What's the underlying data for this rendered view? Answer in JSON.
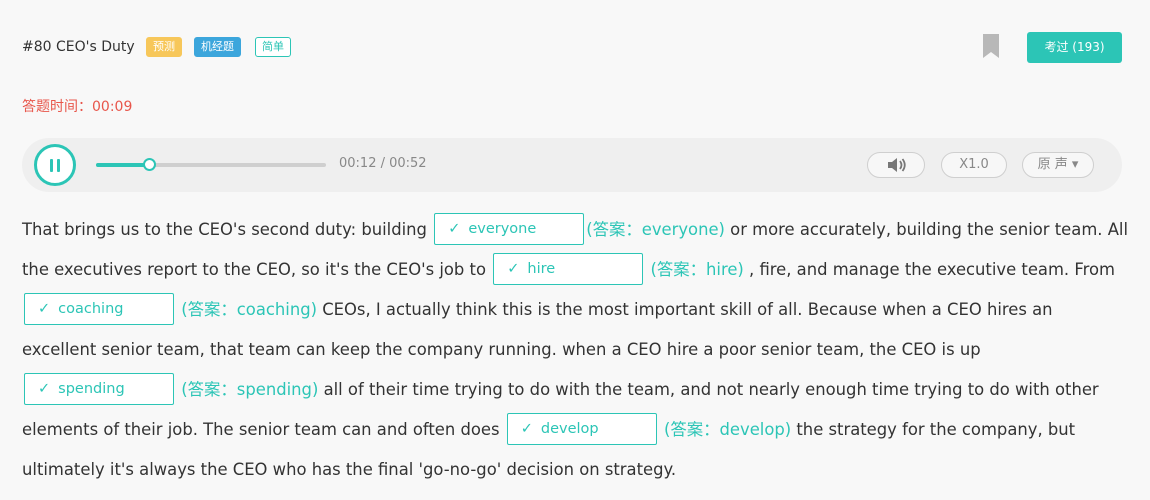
{
  "header": {
    "title": "#80 CEO's Duty",
    "tags": [
      "预测",
      "机经题",
      "简单"
    ],
    "exam_button": "考过 (193)"
  },
  "timer": {
    "label": "答题时间：00:09"
  },
  "player": {
    "time": "00:12 / 00:52",
    "progress_fraction": 0.23,
    "speed": "X1.0",
    "voice": "原 声 ▾"
  },
  "passage": {
    "check": "✓",
    "s0": "That brings us to the CEO's second duty: building ",
    "b1": {
      "value": "everyone",
      "answer": "(答案：everyone)"
    },
    "s1": " or more accurately, building the senior team. All the executives report to the CEO, so it's the CEO's job to ",
    "b2": {
      "value": "hire",
      "answer": "(答案：hire)"
    },
    "s2": " , fire, and manage the executive team. From ",
    "b3": {
      "value": "coaching",
      "answer": "(答案：coaching)"
    },
    "s3": " CEOs, I actually think this is the most important skill of all. Because when a CEO hires an excellent senior team, that team can keep the company running. when a CEO hire a poor senior team, the CEO is up ",
    "b4": {
      "value": "spending",
      "answer": "(答案：spending)"
    },
    "s4": " all of their time trying to do with the team, and not nearly enough time trying to do with other elements of their job. The senior team can and often does ",
    "b5": {
      "value": "develop",
      "answer": "(答案：develop)"
    },
    "s5": " the strategy for the company, but ultimately it's always the CEO who has the final 'go-no-go' decision on strategy."
  },
  "colors": {
    "accent": "#2cc5b6",
    "timer": "#e8564b",
    "tag_predict": "#f7c75a",
    "tag_machine": "#3ca6dc"
  }
}
